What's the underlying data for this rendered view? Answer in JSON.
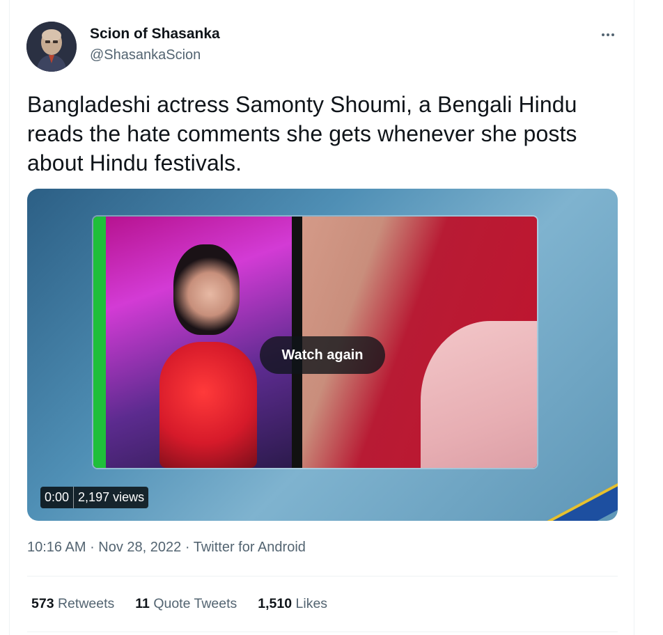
{
  "author": {
    "display_name": "Scion of Shasanka",
    "handle": "@ShasankaScion"
  },
  "tweet": {
    "text": "Bangladeshi actress Samonty Shoumi, a Bengali Hindu reads the hate comments she gets whenever she posts about Hindu festivals."
  },
  "video": {
    "watch_again_label": "Watch again",
    "time": "0:00",
    "views": "2,197 views"
  },
  "meta": {
    "time": "10:16 AM",
    "sep1": " · ",
    "date": "Nov 28, 2022",
    "sep2": " · ",
    "source": "Twitter for Android"
  },
  "stats": {
    "retweets_count": "573",
    "retweets_label": "Retweets",
    "quotes_count": "11",
    "quotes_label": "Quote Tweets",
    "likes_count": "1,510",
    "likes_label": "Likes"
  },
  "icons": {
    "more": "more-horizontal-icon"
  },
  "colors": {
    "text_primary": "#0f1419",
    "text_secondary": "#536471",
    "divider": "#eff3f4"
  }
}
